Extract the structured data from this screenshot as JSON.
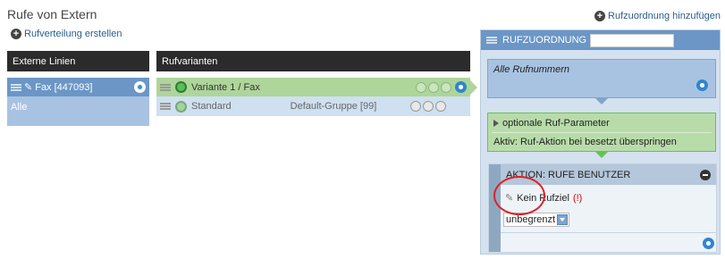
{
  "page": {
    "title": "Rufe von Extern",
    "add_zuordnung_label": "Rufzuordnung hinzufügen",
    "add_verteilung_label": "Rufverteilung erstellen"
  },
  "externe_linien": {
    "header": "Externe Linien",
    "items": [
      {
        "label": "Fax [447093]"
      },
      {
        "label": "Alle"
      }
    ]
  },
  "rufvarianten": {
    "header": "Rufvarianten",
    "items": [
      {
        "name": "Variante 1 / Fax",
        "group": ""
      },
      {
        "name": "Standard",
        "group": "Default-Gruppe [99]"
      }
    ]
  },
  "rufzuordnung": {
    "header": "RUFZUORDNUNG",
    "name_value": "",
    "alle_label": "Alle Rufnummern",
    "optional_title": "optionale Ruf-Parameter",
    "optional_detail": "Aktiv: Ruf-Aktion bei besetzt überspringen",
    "action_title": "AKTION: RUFE BENUTZER",
    "ziel_label": "Kein Rufziel",
    "ziel_warning": "(!)",
    "duration_value": "unbegrenzt"
  },
  "colors": {
    "accent_blue": "#6b96c6",
    "variant_active": "#aed59a",
    "header_dark": "#2b2b2b",
    "highlight_red": "#d22222"
  }
}
